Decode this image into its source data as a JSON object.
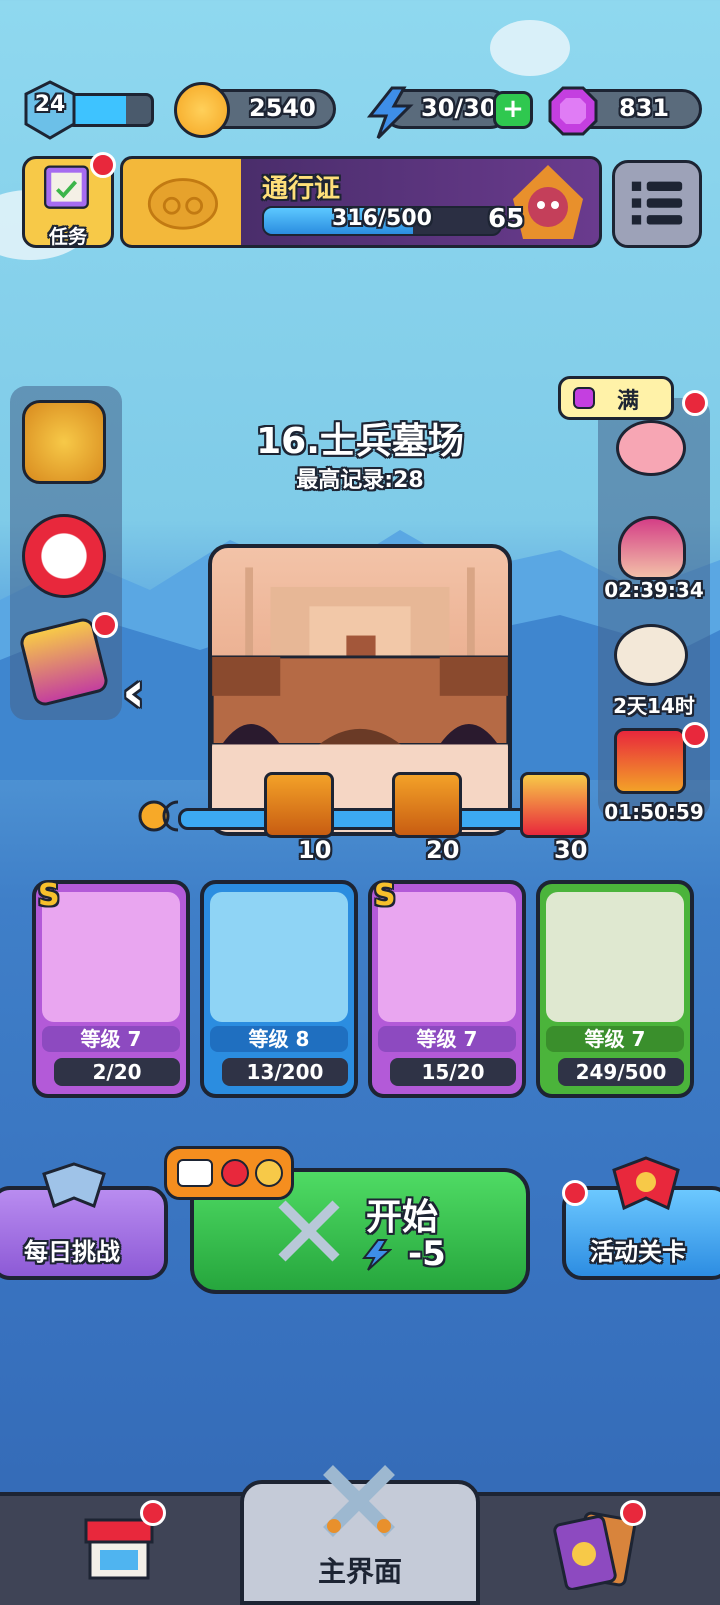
{
  "top_bar": {
    "player_level": "24",
    "xp_fraction": 0.7,
    "coins": "2540",
    "energy": "30/30",
    "gems": "831"
  },
  "task": {
    "label": "任务"
  },
  "pass": {
    "title": "通行证",
    "progress_text": "316/500",
    "progress_fraction": 0.632,
    "level": "65"
  },
  "piggy_bank": {
    "label": "满"
  },
  "timers": {
    "event_1": "02:39:34",
    "event_2": "2天14时",
    "event_3": "01:50:59"
  },
  "stage": {
    "title": "16.士兵墓场",
    "record": "最高记录:28"
  },
  "milestones": [
    {
      "label": "10"
    },
    {
      "label": "20"
    },
    {
      "label": "30"
    }
  ],
  "heroes": [
    {
      "level": "等级 7",
      "count": "2/20",
      "rarity": "S",
      "bg": "#b35ad8"
    },
    {
      "level": "等级 8",
      "count": "13/200",
      "rarity": "",
      "bg": "#2b8de0"
    },
    {
      "level": "等级 7",
      "count": "15/20",
      "rarity": "S",
      "bg": "#b35ad8"
    },
    {
      "level": "等级 7",
      "count": "249/500",
      "rarity": "",
      "bg": "#4bb43b"
    }
  ],
  "buttons": {
    "daily": "每日挑战",
    "start": "开始",
    "start_cost": "-5",
    "event": "活动关卡"
  },
  "nav": {
    "home": "主界面"
  }
}
